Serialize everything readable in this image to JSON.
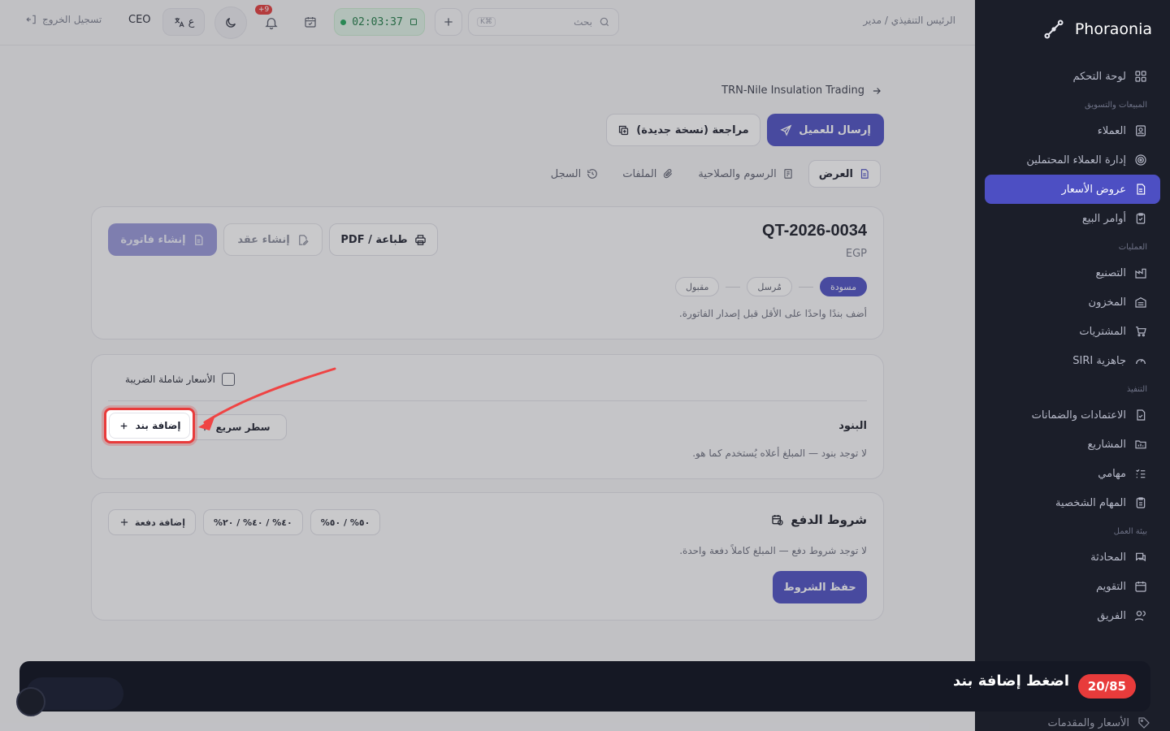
{
  "app": {
    "brand": "Phoraonia"
  },
  "sidebar": {
    "dashboard": "لوحة التحكم",
    "group_sales": "المبيعات والتسويق",
    "clients": "العملاء",
    "leads": "إدارة العملاء المحتملين",
    "quotes": "عروض الأسعار",
    "sales_orders": "أوامر البيع",
    "group_ops": "العمليات",
    "manufacturing": "التصنيع",
    "inventory": "المخزون",
    "purchases": "المشتريات",
    "siri": "جاهزية SIRI",
    "group_exec": "التنفيذ",
    "credits": "الاعتمادات والضمانات",
    "projects": "المشاريع",
    "tasks": "مهامي",
    "personal_tasks": "المهام الشخصية",
    "group_work": "بيئة العمل",
    "chat": "المحادثة",
    "calendar": "التقويم",
    "team": "الفريق",
    "prices": "الأسعار والمقدمات"
  },
  "topbar": {
    "title": "الرئيس التنفيذي / مدير",
    "search_placeholder": "بحث",
    "search_kbd": "K⌘",
    "timer": "02:03:37",
    "notif_badge": "+9",
    "lang": "ع",
    "role": "CEO",
    "logout": "تسجيل الخروج"
  },
  "page": {
    "back_label": "TRN-Nile Insulation Trading",
    "send_button": "إرسال للعميل",
    "revise_button": "مراجعة (نسخة جديدة)",
    "tabs": [
      "العرض",
      "الرسوم والصلاحية",
      "الملفات",
      "السجل"
    ],
    "quote_number": "QT-2026-0034",
    "currency": "EGP",
    "statuses": [
      "مسودة",
      "مُرسل",
      "مقبول"
    ],
    "invoice_hint": "أضف بندًا واحدًا على الأقل قبل إصدار الفاتورة.",
    "create_invoice": "إنشاء فاتورة",
    "create_contract": "إنشاء عقد",
    "print_pdf": "طباعة / PDF",
    "tax_inclusive": "الأسعار شاملة الضريبة",
    "items_title": "البنود",
    "items_hint": "لا توجد بنود — المبلغ أعلاه يُستخدم كما هو.",
    "quick_row": "سطر سريع",
    "add_item": "إضافة بند",
    "payment_title": "شروط الدفع",
    "payment_hint": "لا توجد شروط دفع — المبلغ كاملاً دفعة واحدة.",
    "preset_50": "٥٠% / ٥٠%",
    "preset_40": "٤٠% / ٤٠% / ٢٠%",
    "add_payment": "إضافة دفعة",
    "save_terms": "حفظ الشروط"
  },
  "guide": {
    "counter": "20/85",
    "instruction": "اضغط إضافة بند"
  },
  "colors": {
    "accent": "#4d4fc3",
    "sidebar_bg": "#1b1e29",
    "highlight": "#e83b3b"
  }
}
